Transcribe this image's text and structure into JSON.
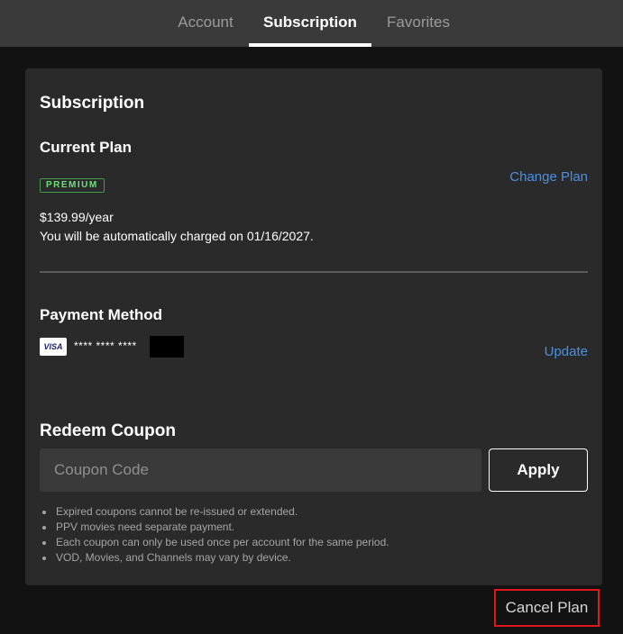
{
  "tabs": [
    {
      "label": "Account",
      "active": false
    },
    {
      "label": "Subscription",
      "active": true
    },
    {
      "label": "Favorites",
      "active": false
    }
  ],
  "card": {
    "title": "Subscription",
    "current_plan": {
      "heading": "Current Plan",
      "badge": "PREMIUM",
      "change_link": "Change Plan",
      "price": "$139.99/year",
      "charge_notice": "You will be automatically charged on 01/16/2027."
    },
    "payment": {
      "heading": "Payment Method",
      "card_brand": "VISA",
      "card_masked": "**** **** ****",
      "update_link": "Update"
    },
    "coupon": {
      "heading": "Redeem Coupon",
      "placeholder": "Coupon Code",
      "value": "",
      "apply_label": "Apply",
      "notes": [
        "Expired coupons cannot be re-issued or extended.",
        "PPV movies need separate payment.",
        "Each coupon can only be used once per account for the same period.",
        "VOD, Movies, and Channels may vary by device."
      ]
    }
  },
  "cancel_label": "Cancel Plan",
  "colors": {
    "background": "#121212",
    "tabbar": "#3a3a3a",
    "card": "#2a2a2b",
    "link": "#4a90e2",
    "badge": "#6ee07a",
    "highlight": "#e0161b"
  }
}
